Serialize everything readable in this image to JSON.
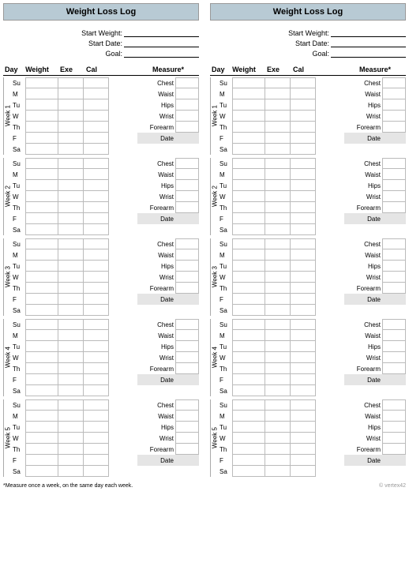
{
  "title": "Weight Loss Log",
  "meta": {
    "start_weight_label": "Start Weight:",
    "start_date_label": "Start Date:",
    "goal_label": "Goal:"
  },
  "headers": {
    "day": "Day",
    "weight": "Weight",
    "exe": "Exe",
    "cal": "Cal",
    "measure": "Measure*"
  },
  "days": [
    "Su",
    "M",
    "Tu",
    "W",
    "Th",
    "F",
    "Sa"
  ],
  "weeks": [
    "Week 1",
    "Week 2",
    "Week 3",
    "Week 4",
    "Week 5"
  ],
  "measures": [
    "Chest",
    "Waist",
    "Hips",
    "Wrist",
    "Forearm",
    "Date"
  ],
  "footnote": "*Measure once a week, on the same day each week.",
  "watermark": "© vertex42"
}
